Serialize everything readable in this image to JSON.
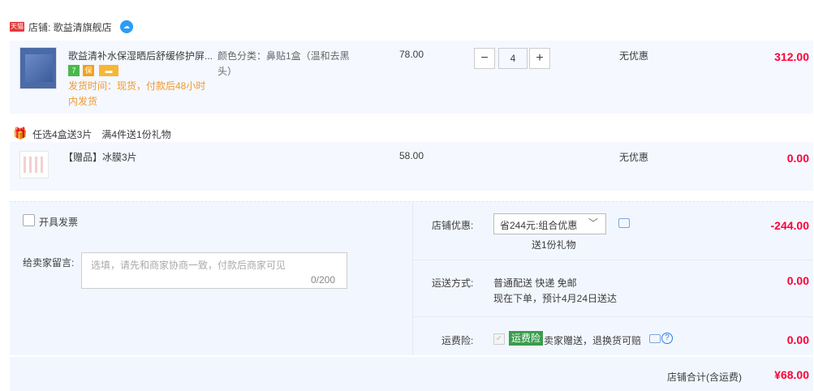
{
  "shop": {
    "badge": "天猫",
    "label": "店铺: 歌益清旗舰店",
    "chat_icon": "wangwang-chat-icon"
  },
  "item1": {
    "title": "歌益清补水保湿晒后舒缓修护屏...",
    "service_icons": [
      "7-day-return-icon",
      "guarantee-icon",
      "card-pay-icon"
    ],
    "ship_time": "发货时间：现货，付款后48小时内发货",
    "spec": "颜色分类：鼻贴1盒（温和去黑头）",
    "price": "78.00",
    "quantity": "4",
    "discount": "无优惠",
    "subtotal": "312.00"
  },
  "promo": {
    "icon": "gift-icon",
    "text": "任选4盒送3片　满4件送1份礼物"
  },
  "item2": {
    "title": "【赠品】冰膜3片",
    "price": "58.00",
    "discount": "无优惠",
    "subtotal": "0.00"
  },
  "order": {
    "invoice_label": "开具发票",
    "message_label": "给卖家留言:",
    "message_placeholder": "选填，请先和商家协商一致，付款后商家可见",
    "message_count": "0/200",
    "coupon_label": "店铺优惠:",
    "coupon_value": "省244元:组合优惠",
    "coupon_gift": "送1份礼物",
    "coupon_amount": "-244.00",
    "shipping_label": "运送方式:",
    "shipping_line1": "普通配送 快递 免邮",
    "shipping_line2": "现在下单，预计4月24日送达",
    "shipping_amount": "0.00",
    "insurance_label": "运费险:",
    "insurance_badge": "运费险",
    "insurance_text": "卖家赠送，退换货可赔",
    "insurance_amount": "0.00",
    "total_label": "店铺合计(含运费)",
    "total_amount": "¥68.00"
  },
  "colors": {
    "price_red": "#ff0036",
    "panel_bg": "#f2f7ff",
    "ship_orange": "#f39a2b",
    "insurance_green": "#3a9c4e"
  }
}
